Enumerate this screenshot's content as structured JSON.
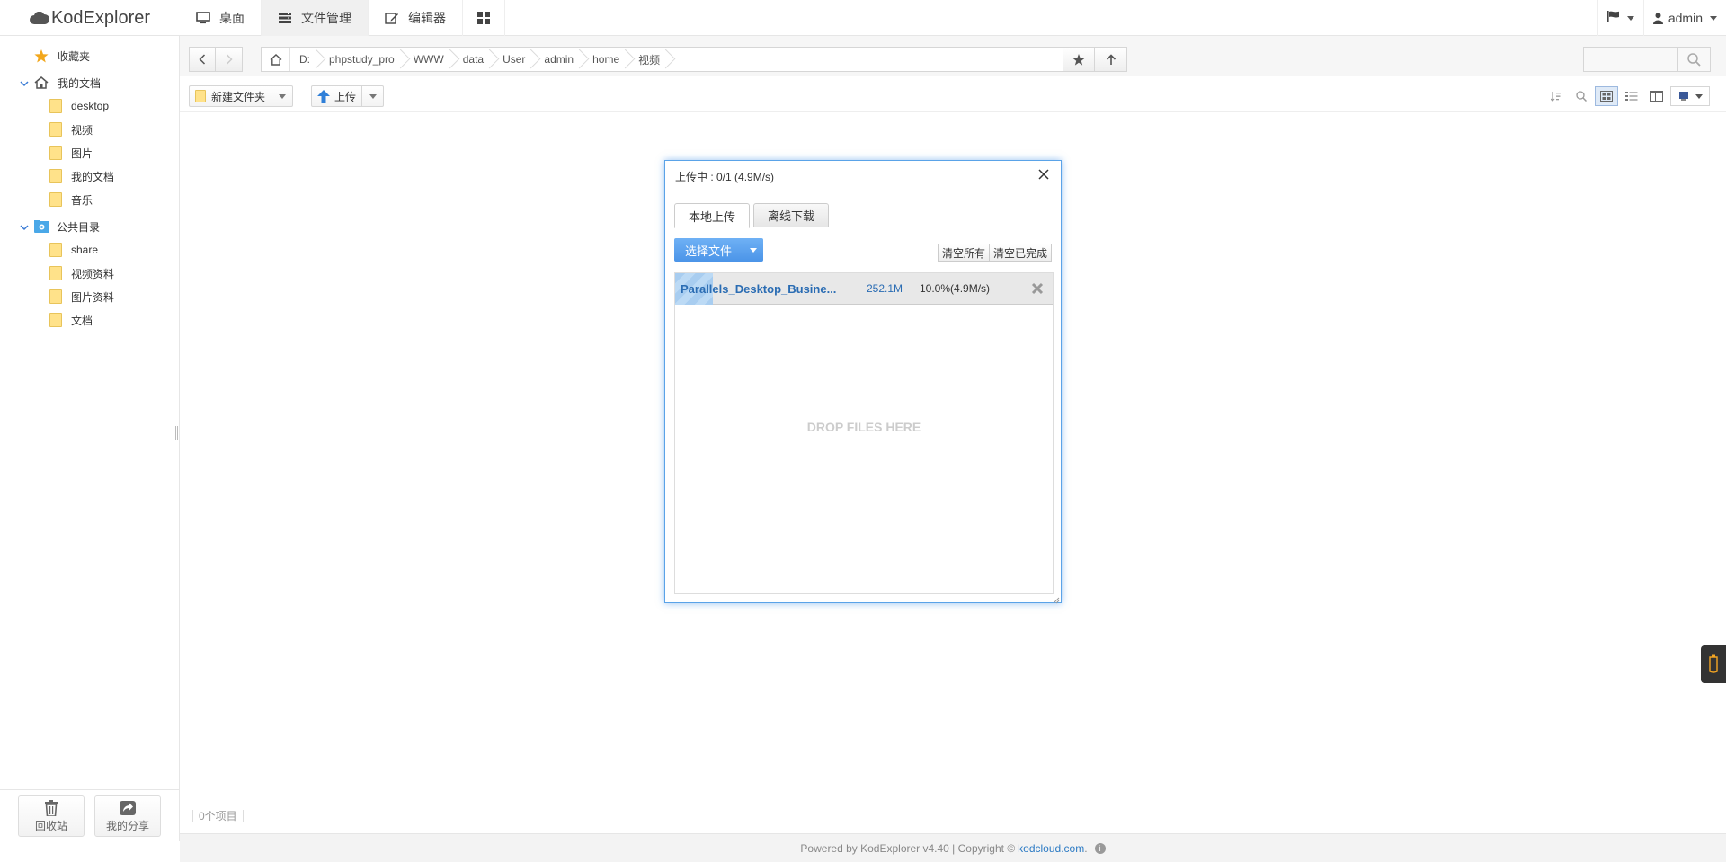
{
  "app": {
    "name": "KodExplorer"
  },
  "nav": {
    "items": [
      {
        "label": "桌面",
        "icon": "desktop-icon"
      },
      {
        "label": "文件管理",
        "icon": "file-manager-icon"
      },
      {
        "label": "编辑器",
        "icon": "editor-icon"
      },
      {
        "label": "",
        "icon": "apps-grid-icon"
      }
    ]
  },
  "user": {
    "name": "admin"
  },
  "sidebar": {
    "favorites": "收藏夹",
    "my_docs": "我的文档",
    "my_doc_children": [
      "desktop",
      "视频",
      "图片",
      "我的文档",
      "音乐"
    ],
    "public": "公共目录",
    "public_children": [
      "share",
      "视频资料",
      "图片资料",
      "文档"
    ],
    "recycle": "回收站",
    "my_share": "我的分享"
  },
  "breadcrumbs": [
    "D:",
    "phpstudy_pro",
    "WWW",
    "data",
    "User",
    "admin",
    "home",
    "视频"
  ],
  "search": {
    "placeholder": ""
  },
  "toolbar": {
    "new_folder": "新建文件夹",
    "upload": "上传"
  },
  "status": {
    "count": "0个项目"
  },
  "footer": {
    "text": "Powered by KodExplorer v4.40 | Copyright ©",
    "link": "kodcloud.com",
    "after": ".",
    "info": "i"
  },
  "dialog": {
    "title": "上传中 : 0/1 (4.9M/s)",
    "tabs": [
      "本地上传",
      "离线下载"
    ],
    "choose_file": "选择文件",
    "clear_all": "清空所有",
    "clear_done": "清空已完成",
    "item": {
      "name": "Parallels_Desktop_Busine...",
      "size": "252.1M",
      "status": "10.0%(4.9M/s)",
      "progress": 0.1
    },
    "drop_hint": "DROP FILES HERE"
  },
  "colors": {
    "accent": "#4b94e8",
    "link": "#2d7bc4",
    "folder": "#ffe28a"
  }
}
